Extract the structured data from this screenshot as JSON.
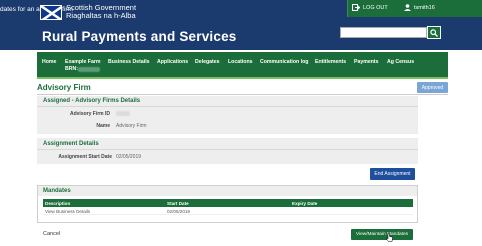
{
  "header": {
    "cut_text": "dates for an advisory firm",
    "gov_line1": "Scottish Government",
    "gov_line2": "Riaghaltas na h-Alba",
    "title": "Rural Payments and Services",
    "logout_label": "LOG OUT",
    "username": "tsmith16",
    "search": {
      "value": "",
      "placeholder": ""
    }
  },
  "nav": {
    "items": [
      {
        "label": "Home"
      },
      {
        "label": "Example Farm",
        "sub": "BRN:"
      },
      {
        "label": "Business Details"
      },
      {
        "label": "Applications"
      },
      {
        "label": "Delegates"
      },
      {
        "label": "Locations"
      },
      {
        "label": "Communication log"
      },
      {
        "label": "Entitlements"
      },
      {
        "label": "Payments"
      },
      {
        "label": "Ag Census"
      }
    ]
  },
  "page": {
    "title": "Advisory Firm",
    "status_button": "Approved"
  },
  "assigned": {
    "title": "Assigned - Advisory Firms Details",
    "firm_id_label": "Advisory Firm ID",
    "name_label": "Name",
    "name_value": "Advisory Firm"
  },
  "assignment": {
    "title": "Assignment Details",
    "start_date_label": "Assignment Start Date",
    "start_date_value": "02/05/2019",
    "end_button": "End Assignment"
  },
  "mandates": {
    "title": "Mandates",
    "columns": [
      "Description",
      "Start Date",
      "Expiry Date"
    ],
    "rows": [
      {
        "description": "View Business Details",
        "start_date": "02/05/2019",
        "expiry_date": ""
      }
    ]
  },
  "footer": {
    "cancel": "Cancel",
    "view_maintain": "View/Maintain Mandates"
  },
  "colors": {
    "header_blue": "#1b3a6e",
    "brand_green": "#1b6e3a",
    "accent_blue": "#1f4e9c",
    "approved_blue": "#7aa6d6"
  }
}
